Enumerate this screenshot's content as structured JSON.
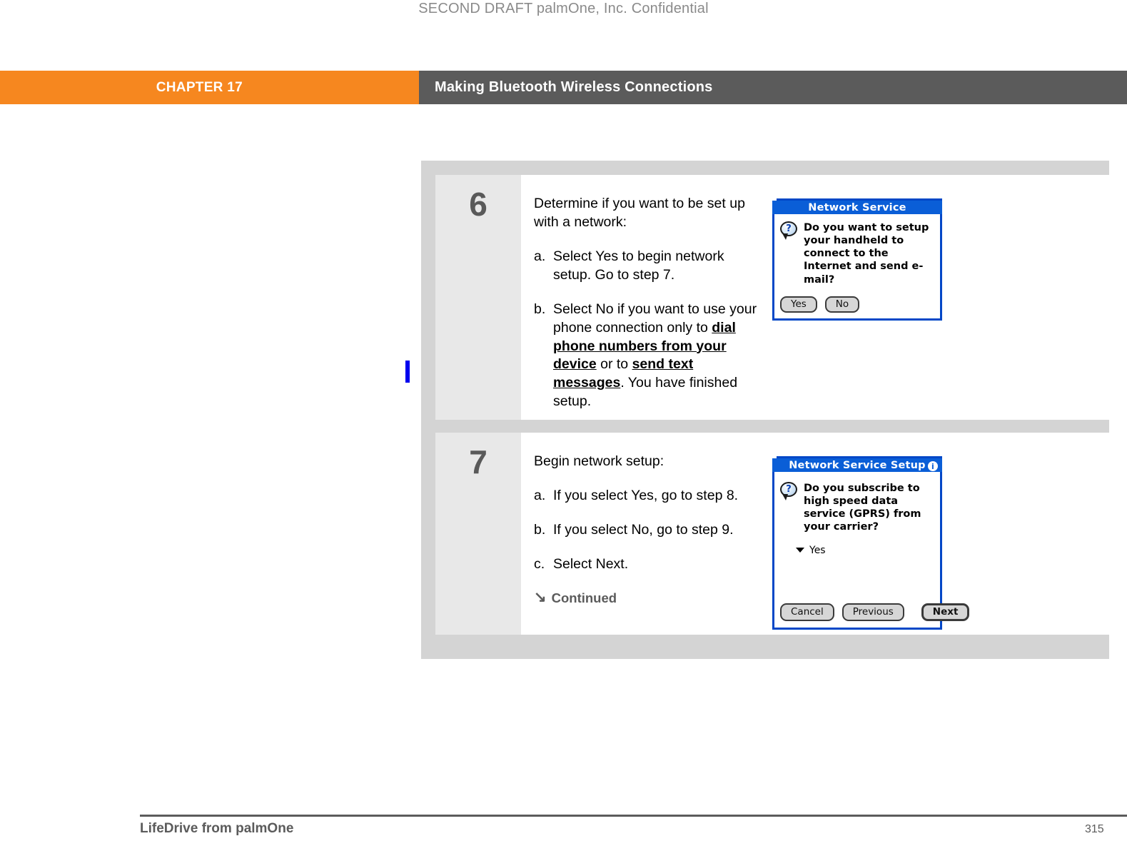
{
  "draft_notice": "SECOND DRAFT palmOne, Inc.  Confidential",
  "header": {
    "chapter_label": "CHAPTER 17",
    "chapter_title": "Making Bluetooth Wireless Connections",
    "orange_hex": "#f6871f",
    "gray_hex": "#5b5b5b"
  },
  "change_bar": {
    "color_hex": "#0000ee"
  },
  "steps": [
    {
      "number": "6",
      "lead": "Determine if you want to be set up with a network:",
      "items": [
        {
          "marker": "a.",
          "pre": "Select Yes to begin network setup. Go to step 7.",
          "link1": "",
          "mid": "",
          "link2": "",
          "post": ""
        },
        {
          "marker": "b.",
          "pre": "Select No if you want to use your phone connection only to ",
          "link1": "dial phone numbers from your device",
          "mid": " or to ",
          "link2": "send text messages",
          "post": ". You have finished setup."
        }
      ],
      "continued": null,
      "dialog": {
        "title": "Network Service",
        "has_info_icon": false,
        "question": "Do you want to setup your handheld to connect to the Internet and send e-mail?",
        "select_value": null,
        "buttons": [
          {
            "label": "Yes",
            "primary": false
          },
          {
            "label": "No",
            "primary": false
          }
        ]
      }
    },
    {
      "number": "7",
      "lead": "Begin network setup:",
      "items": [
        {
          "marker": "a.",
          "pre": "If you select Yes, go to step 8.",
          "link1": "",
          "mid": "",
          "link2": "",
          "post": ""
        },
        {
          "marker": "b.",
          "pre": "If you select No, go to step 9.",
          "link1": "",
          "mid": "",
          "link2": "",
          "post": ""
        },
        {
          "marker": "c.",
          "pre": "Select Next.",
          "link1": "",
          "mid": "",
          "link2": "",
          "post": ""
        }
      ],
      "continued": "Continued",
      "continued_icon": "↘",
      "dialog": {
        "title": "Network Service Setup",
        "has_info_icon": true,
        "info_icon_glyph": "i",
        "question": "Do you subscribe to high speed data service (GPRS) from your carrier?",
        "select_value": "Yes",
        "buttons": [
          {
            "label": "Cancel",
            "primary": false
          },
          {
            "label": "Previous",
            "primary": false
          },
          {
            "label": "Next",
            "primary": true
          }
        ]
      }
    }
  ],
  "footer": {
    "left": "LifeDrive from palmOne",
    "page_number": "315"
  }
}
